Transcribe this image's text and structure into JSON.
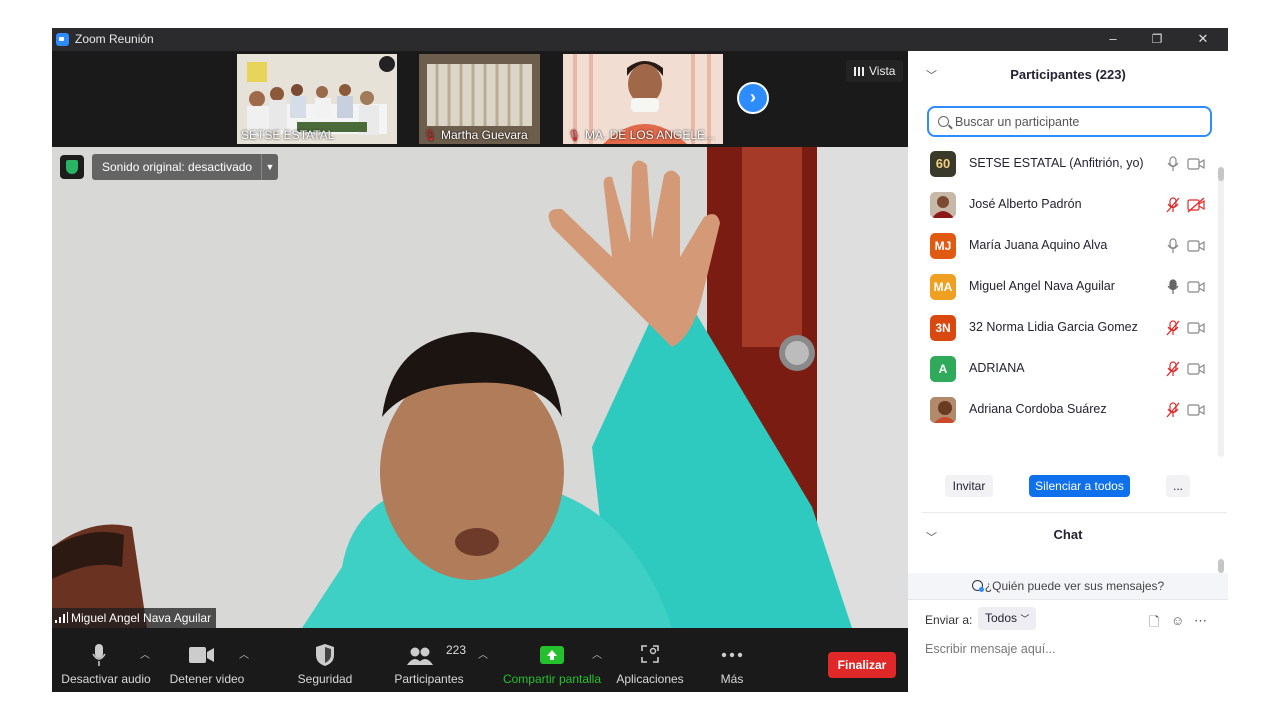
{
  "window": {
    "title": "Zoom Reunión",
    "minimize": "–",
    "restore": "❐",
    "close": "✕"
  },
  "video": {
    "thumbnails": [
      {
        "name": "SETSE ESTATAL",
        "muted": false
      },
      {
        "name": "Martha Guevara",
        "muted": true
      },
      {
        "name": "MA. DE LOS ANGELE...",
        "muted": true
      }
    ],
    "view_label": "Vista",
    "next_icon": "chevron-right-icon",
    "original_sound_label": "Sonido original: desactivado",
    "active_speaker": "Miguel Angel Nava Aguilar",
    "security_badge_color": "#28b463"
  },
  "toolbar": {
    "mute_audio": "Desactivar audio",
    "stop_video": "Detener video",
    "security": "Seguridad",
    "participants": "Participantes",
    "participants_count": "223",
    "share_screen": "Compartir pantalla",
    "apps": "Aplicaciones",
    "more": "Más",
    "end": "Finalizar",
    "share_color": "#25c02e",
    "end_color": "#e02828"
  },
  "participants_panel": {
    "title": "Participantes (223)",
    "search_placeholder": "Buscar un participante",
    "items": [
      {
        "name": "SETSE ESTATAL (Anfitrión, yo)",
        "initials": "60",
        "avatar_color": "#3a3a2a",
        "mic": "on",
        "video": "on"
      },
      {
        "name": "José Alberto Padrón",
        "initials": "",
        "avatar_color": "#8a3a2a",
        "mic": "muted",
        "video": "off"
      },
      {
        "name": "María Juana Aquino Alva",
        "initials": "MJ",
        "avatar_color": "#e05a12",
        "mic": "on",
        "video": "on"
      },
      {
        "name": "Miguel Angel Nava Aguilar",
        "initials": "MA",
        "avatar_color": "#f0a020",
        "mic": "speaking",
        "video": "on"
      },
      {
        "name": "32 Norma Lidia Garcia Gomez",
        "initials": "3N",
        "avatar_color": "#d9480f",
        "mic": "muted",
        "video": "on"
      },
      {
        "name": "ADRIANA",
        "initials": "A",
        "avatar_color": "#2eaa5a",
        "mic": "muted",
        "video": "on"
      },
      {
        "name": "Adriana Cordoba Suárez",
        "initials": "",
        "avatar_color": "#a0704a",
        "mic": "muted",
        "video": "on"
      }
    ],
    "invite": "Invitar",
    "mute_all": "Silenciar a todos",
    "more": "..."
  },
  "chat_panel": {
    "title": "Chat",
    "who_can_see": "¿Quién puede ver sus mensajes?",
    "send_to_label": "Enviar a:",
    "send_to_value": "Todos",
    "message_placeholder": "Escribir mensaje aquí..."
  }
}
